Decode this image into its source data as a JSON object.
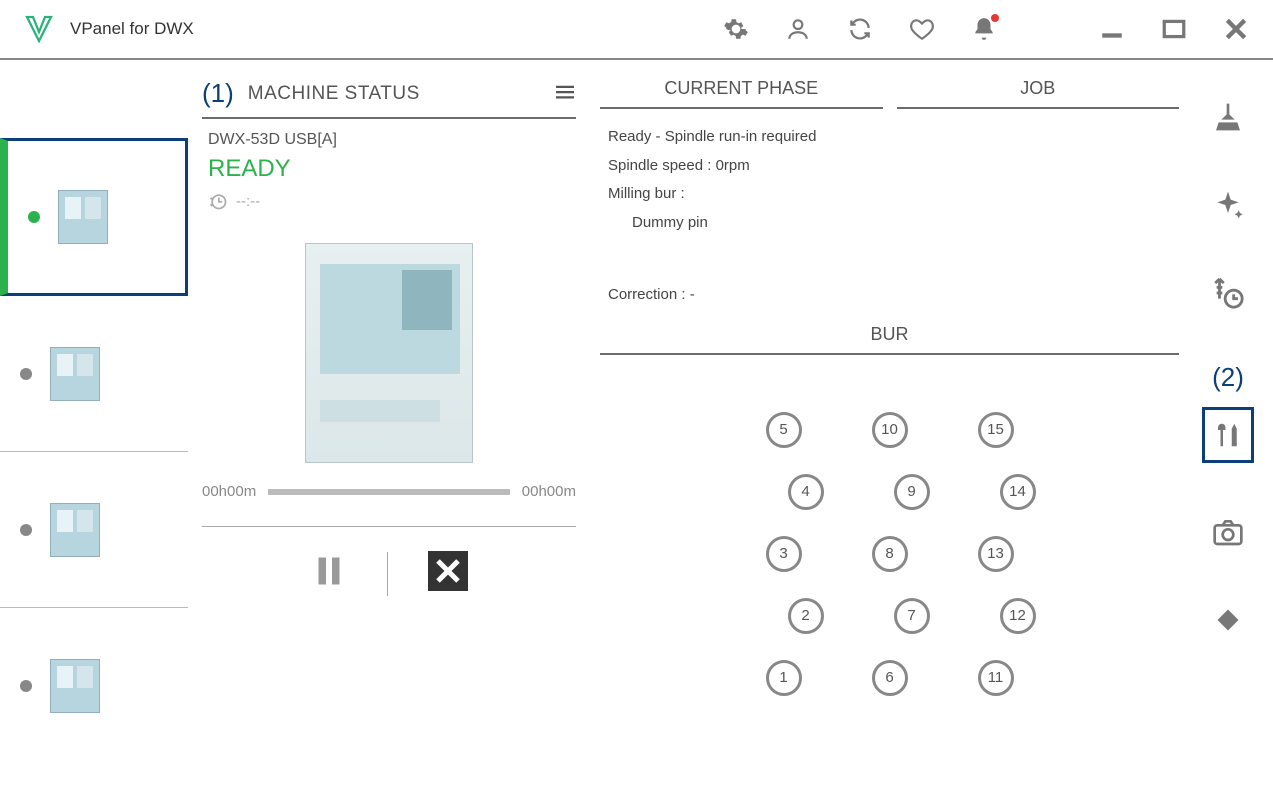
{
  "app": {
    "title": "VPanel for DWX"
  },
  "callouts": {
    "one": "(1)",
    "two": "(2)"
  },
  "machine_status": {
    "heading": "MACHINE STATUS",
    "name": "DWX-53D USB[A]",
    "status": "READY",
    "elapsed": "--:--",
    "progress_start": "00h00m",
    "progress_end": "00h00m"
  },
  "current_phase": {
    "heading": "CURRENT PHASE",
    "line1": "Ready - Spindle run-in required",
    "line2": "Spindle speed : 0rpm",
    "line3": "Milling bur :",
    "line3b": "Dummy pin",
    "line4": "Correction : -"
  },
  "job": {
    "heading": "JOB"
  },
  "bur": {
    "heading": "BUR",
    "cols": [
      [
        "1",
        "2",
        "3",
        "4",
        "5"
      ],
      [
        "6",
        "7",
        "8",
        "9",
        "10"
      ],
      [
        "11",
        "12",
        "13",
        "14",
        "15"
      ]
    ]
  }
}
